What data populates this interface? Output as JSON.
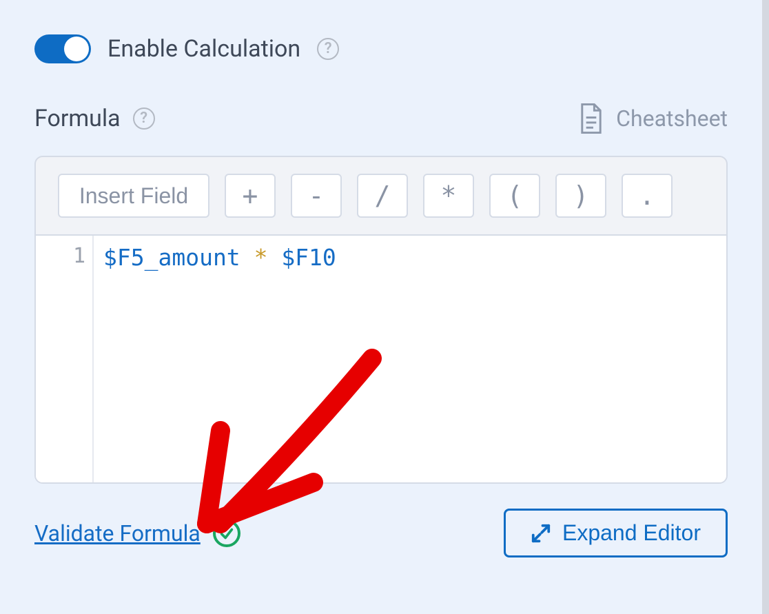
{
  "toggle": {
    "label": "Enable Calculation"
  },
  "section": {
    "title": "Formula",
    "cheatsheet": "Cheatsheet"
  },
  "toolbar": {
    "insert_field": "Insert Field",
    "plus": "+",
    "minus": "-",
    "divide": "/",
    "multiply": "*",
    "lparen": "(",
    "rparen": ")",
    "dot": "."
  },
  "code": {
    "line_number": "1",
    "var1": "$F5_amount",
    "op": "*",
    "var2": "$F10"
  },
  "footer": {
    "validate": "Validate Formula",
    "expand": "Expand Editor"
  }
}
